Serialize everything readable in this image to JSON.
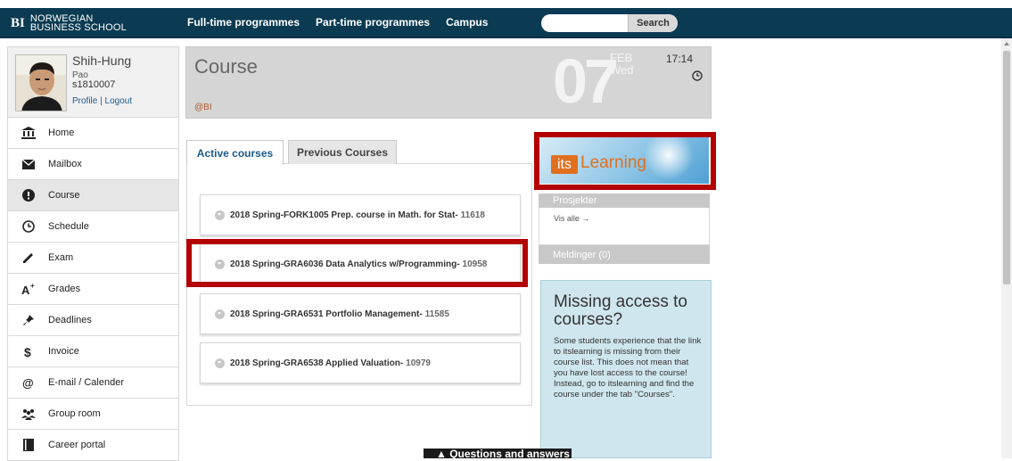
{
  "brand": {
    "mark": "BI",
    "line1": "NORWEGIAN",
    "line2": "BUSINESS SCHOOL"
  },
  "nav": {
    "links": [
      "Full-time programmes",
      "Part-time programmes",
      "Campus"
    ],
    "search_placeholder": "",
    "search_button": "Search"
  },
  "profile": {
    "name": "Shih-Hung",
    "subname": "Pao",
    "student_id": "s1810007",
    "profile_link": "Profile",
    "separator": " | ",
    "logout_link": "Logout"
  },
  "sidebar": {
    "items": [
      {
        "label": "Home",
        "icon": "bank-icon"
      },
      {
        "label": "Mailbox",
        "icon": "mail-icon"
      },
      {
        "label": "Course",
        "icon": "exclamation-icon",
        "active": true
      },
      {
        "label": "Schedule",
        "icon": "clock-icon"
      },
      {
        "label": "Exam",
        "icon": "pencil-icon"
      },
      {
        "label": "Grades",
        "icon": "grade-a-plus-icon"
      },
      {
        "label": "Deadlines",
        "icon": "pushpin-icon"
      },
      {
        "label": "Invoice",
        "icon": "dollar-icon"
      },
      {
        "label": "E-mail / Calender",
        "icon": "at-icon"
      },
      {
        "label": "Group room",
        "icon": "group-icon"
      },
      {
        "label": "Career portal",
        "icon": "book-icon"
      }
    ]
  },
  "header": {
    "title": "Course",
    "org": "@BI",
    "day": "07",
    "month": "FEB",
    "weekday": "Wed",
    "time": "17:14"
  },
  "tabs": {
    "active": "Active courses",
    "previous": "Previous Courses"
  },
  "courses": [
    {
      "term": "2018 Spring",
      "sep": " - ",
      "name": "FORK1005 Prep. course in Math. for Stat",
      "code": "11618",
      "highlighted": false
    },
    {
      "term": "2018 Spring",
      "sep": " - ",
      "name": "GRA6036 Data Analytics w/Programming",
      "code": "10958",
      "highlighted": true
    },
    {
      "term": "2018 Spring",
      "sep": " - ",
      "name": "GRA6531 Portfolio Management",
      "code": "11585",
      "highlighted": false
    },
    {
      "term": "2018 Spring",
      "sep": " - ",
      "name": "GRA6538 Applied Valuation",
      "code": "10979",
      "highlighted": false
    }
  ],
  "itslearning": {
    "its": "its",
    "learning": "Learning",
    "projects_label": "Prosjekter",
    "see_all": "Vis alle →",
    "messages_label": "Meldinger (0)"
  },
  "missing": {
    "title": "Missing access to courses?",
    "body": "Some students experience that the link to itslearning is missing from their course list. This does not mean that you have lost access to the course! Instead, go to itslearning and find the course under the tab \"Courses\"."
  },
  "qa": {
    "label": "Questions and answers"
  },
  "colors": {
    "navbar": "#0b3b52",
    "highlight": "#b30000",
    "link": "#1a5b8c",
    "accent_orange": "#e0701e"
  }
}
